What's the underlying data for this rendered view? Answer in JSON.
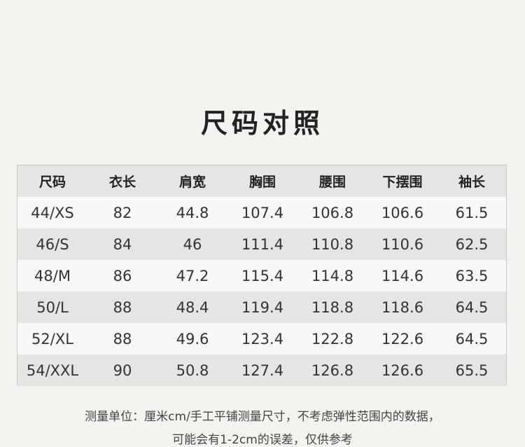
{
  "title": "尺码对照",
  "table": {
    "headers": [
      "尺码",
      "衣长",
      "肩宽",
      "胸围",
      "腰围",
      "下摆围",
      "袖长"
    ],
    "rows": [
      [
        "44/XS",
        "82",
        "44.8",
        "107.4",
        "106.8",
        "106.6",
        "61.5"
      ],
      [
        "46/S",
        "84",
        "46",
        "111.4",
        "110.8",
        "110.6",
        "62.5"
      ],
      [
        "48/M",
        "86",
        "47.2",
        "115.4",
        "114.8",
        "114.6",
        "63.5"
      ],
      [
        "50/L",
        "88",
        "48.4",
        "119.4",
        "118.8",
        "118.6",
        "64.5"
      ],
      [
        "52/XL",
        "88",
        "49.6",
        "123.4",
        "122.8",
        "122.6",
        "64.5"
      ],
      [
        "54/XXL",
        "90",
        "50.8",
        "127.4",
        "126.8",
        "126.6",
        "65.5"
      ]
    ]
  },
  "note": {
    "line1": "测量单位：厘米cm/手工平铺测量尺寸，不考虑弹性范围内的数据，",
    "line2": "可能会有1-2cm的误差，仅供参考"
  }
}
